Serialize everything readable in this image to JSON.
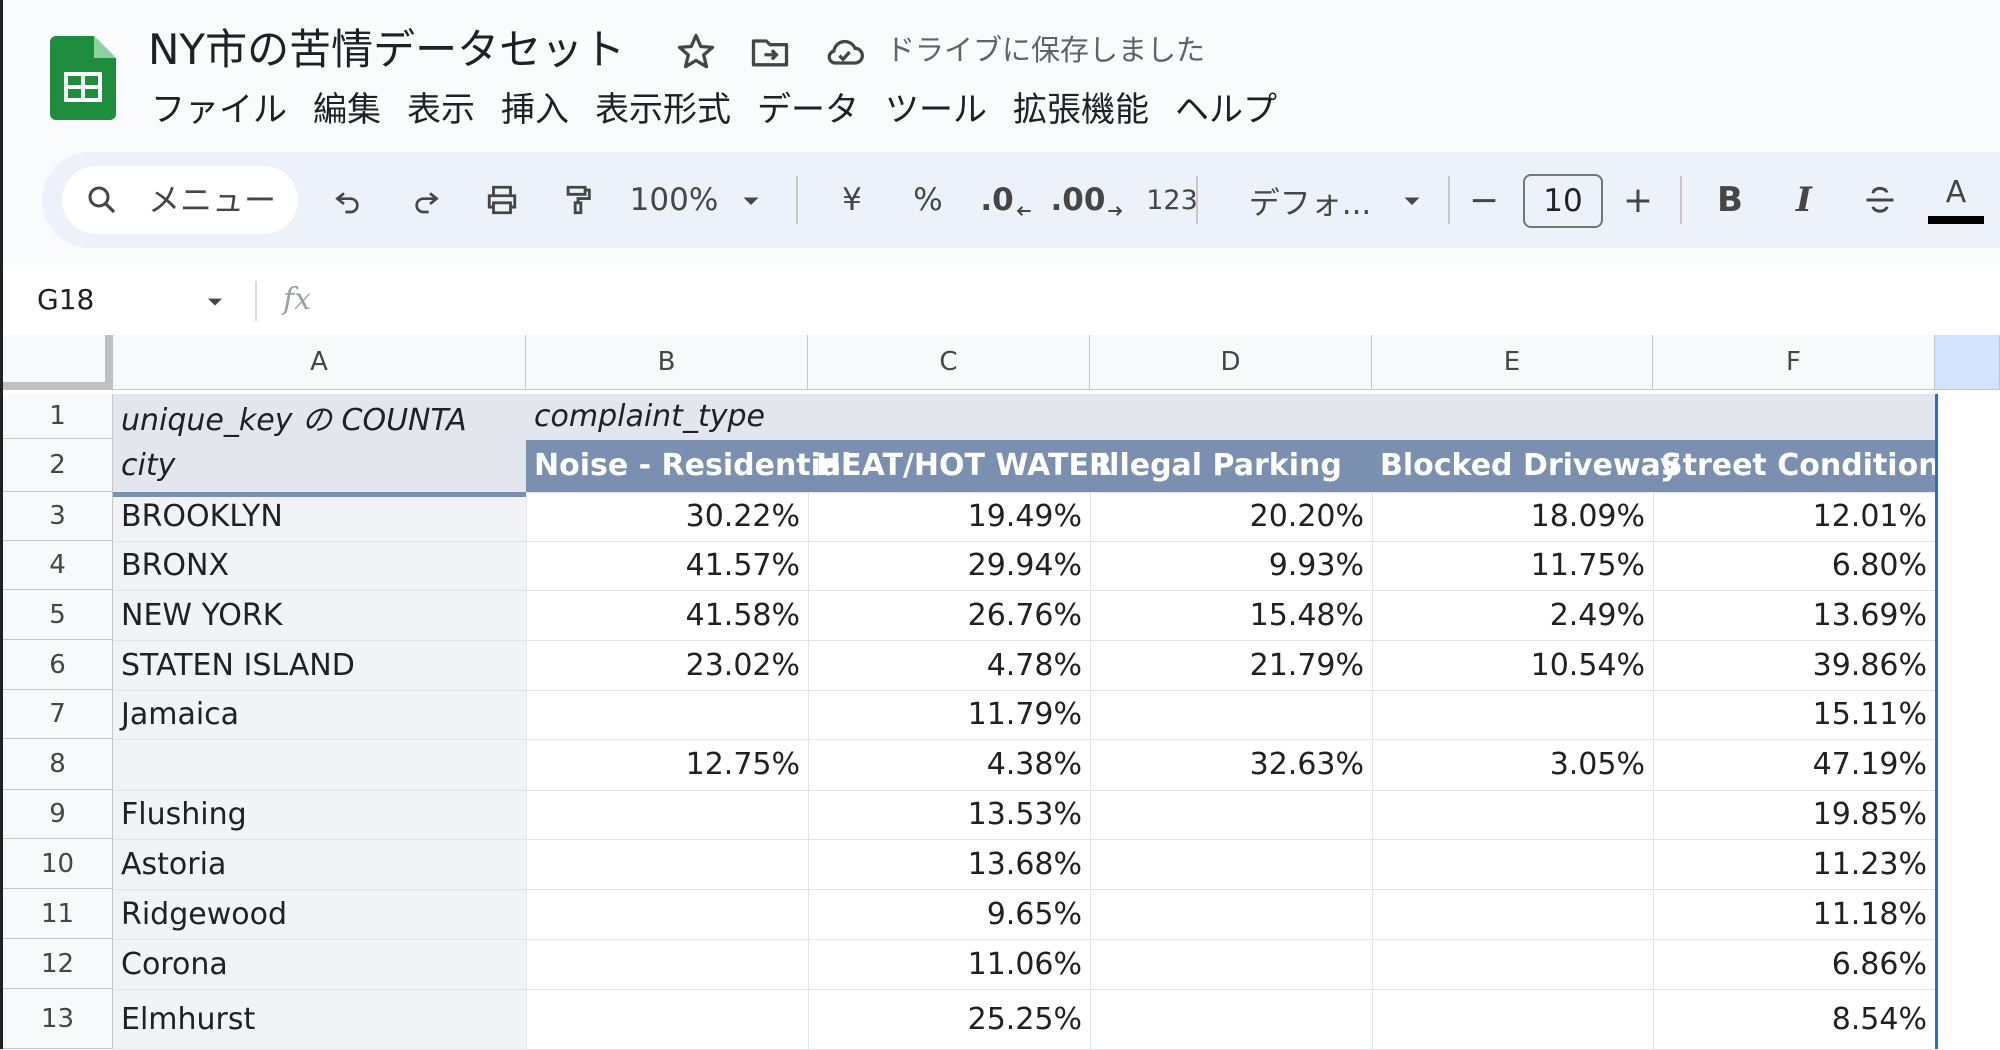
{
  "app": {
    "title": "NY市の苦情データセット",
    "save_status": "ドライブに保存しました"
  },
  "menu": [
    "ファイル",
    "編集",
    "表示",
    "挿入",
    "表示形式",
    "データ",
    "ツール",
    "拡張機能",
    "ヘルプ"
  ],
  "toolbar": {
    "search_label": "メニュー",
    "zoom": "100%",
    "currency": "¥",
    "percent": "%",
    "decimal_decrease": ".0",
    "decimal_increase": ".00",
    "number_format": "123",
    "font_name": "デフォ...",
    "font_size": "10",
    "minus": "−",
    "plus": "+",
    "bold": "B",
    "italic": "I",
    "text_color": "A"
  },
  "formula_bar": {
    "cell_ref": "G18",
    "fx": "fx",
    "value": ""
  },
  "columns": [
    "A",
    "B",
    "C",
    "D",
    "E",
    "F"
  ],
  "rows": [
    "1",
    "2",
    "3",
    "4",
    "5",
    "6",
    "7",
    "8",
    "9",
    "10",
    "11",
    "12",
    "13"
  ],
  "pivot": {
    "corner_label": "unique_key の COUNTA",
    "col_field": "complaint_type",
    "row_field": "city",
    "headers": [
      "Noise - Residential",
      "HEAT/HOT WATER",
      "Illegal Parking",
      "Blocked Driveway",
      "Street Condition"
    ],
    "data": [
      {
        "city": "BROOKLYN",
        "values": [
          "30.22%",
          "19.49%",
          "20.20%",
          "18.09%",
          "12.01%"
        ]
      },
      {
        "city": "BRONX",
        "values": [
          "41.57%",
          "29.94%",
          "9.93%",
          "11.75%",
          "6.80%"
        ]
      },
      {
        "city": "NEW YORK",
        "values": [
          "41.58%",
          "26.76%",
          "15.48%",
          "2.49%",
          "13.69%"
        ]
      },
      {
        "city": "STATEN ISLAND",
        "values": [
          "23.02%",
          "4.78%",
          "21.79%",
          "10.54%",
          "39.86%"
        ]
      },
      {
        "city": "Jamaica",
        "values": [
          "",
          "11.79%",
          "",
          "",
          "15.11%"
        ]
      },
      {
        "city": "",
        "values": [
          "12.75%",
          "4.38%",
          "32.63%",
          "3.05%",
          "47.19%"
        ]
      },
      {
        "city": "Flushing",
        "values": [
          "",
          "13.53%",
          "",
          "",
          "19.85%"
        ]
      },
      {
        "city": "Astoria",
        "values": [
          "",
          "13.68%",
          "",
          "",
          "11.23%"
        ]
      },
      {
        "city": "Ridgewood",
        "values": [
          "",
          "9.65%",
          "",
          "",
          "11.18%"
        ]
      },
      {
        "city": "Corona",
        "values": [
          "",
          "11.06%",
          "",
          "",
          "6.86%"
        ]
      },
      {
        "city": "Elmhurst",
        "values": [
          "",
          "25.25%",
          "",
          "",
          "8.54%"
        ]
      }
    ]
  },
  "colors": {
    "header_band": "#e3e6ec",
    "column_band": "#7b8fb0",
    "selection": "#1a73e8",
    "sheets_green": "#1e8e3e"
  }
}
